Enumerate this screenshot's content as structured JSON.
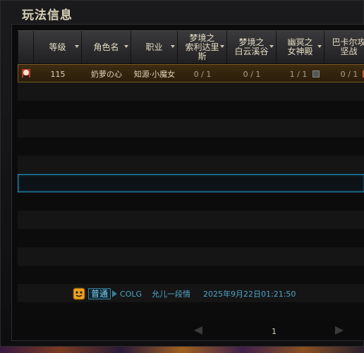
{
  "window": {
    "title": "玩法信息"
  },
  "columns": [
    {
      "label": "等级",
      "sortable": true
    },
    {
      "label": "角色名",
      "sortable": true
    },
    {
      "label": "职业",
      "sortable": true
    },
    {
      "label": "梦境之\n索利达里\n斯",
      "sortable": true
    },
    {
      "label": "梦境之\n白云溪谷",
      "sortable": true
    },
    {
      "label": "幽冥之\n女神殿",
      "sortable": true
    },
    {
      "label": "巴卡尔攻\n坚战",
      "sortable": false
    }
  ],
  "rows": [
    {
      "level": "115",
      "name": "奶萝の心",
      "job": "知源·小魔女",
      "d1": "0 / 1",
      "d2": "0 / 1",
      "d3": "1 / 1",
      "d4": "0 / 1"
    }
  ],
  "chat": {
    "channel": "普通",
    "sender": "COLG",
    "message": "允儿一段情",
    "time": "2025年9月22日01:21:50"
  },
  "pagination": {
    "current": "1"
  },
  "colors": {
    "accent": "#1f8fbf",
    "selected_row": "#3e2c12",
    "title": "#d8d1b8"
  }
}
